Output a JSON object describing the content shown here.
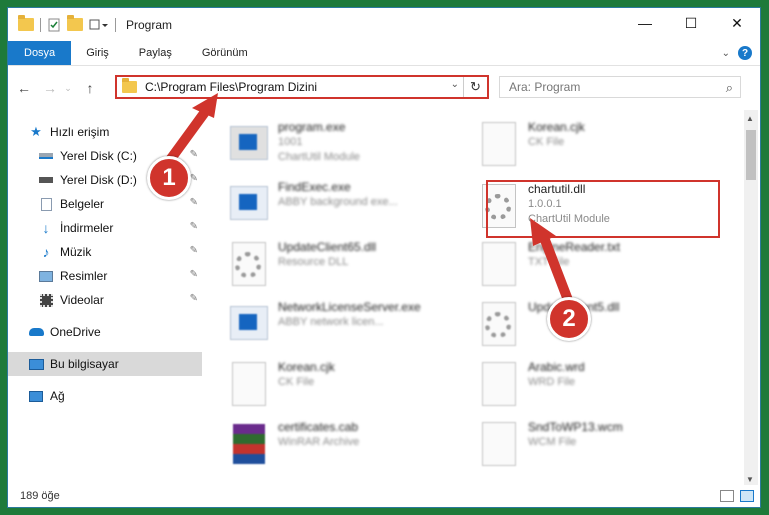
{
  "window": {
    "title": "Program",
    "controls": {
      "minimize": "—",
      "maximize": "☐",
      "close": "✕"
    }
  },
  "ribbon": {
    "tabs": [
      {
        "label": "Dosya",
        "active": true
      },
      {
        "label": "Giriş"
      },
      {
        "label": "Paylaş"
      },
      {
        "label": "Görünüm"
      }
    ],
    "help_label": "?"
  },
  "nav": {
    "address": "C:\\Program Files\\Program Dizini",
    "search_placeholder": "Ara: Program"
  },
  "sidebar": {
    "items": [
      {
        "label": "Hızlı erişim",
        "icon": "star-icon"
      },
      {
        "label": "Yerel Disk (C:)",
        "icon": "drive-icon",
        "pinned": true
      },
      {
        "label": "Yerel Disk (D:)",
        "icon": "drive-icon",
        "pinned": true
      },
      {
        "label": "Belgeler",
        "icon": "documents-icon",
        "pinned": true
      },
      {
        "label": "İndirmeler",
        "icon": "download-icon",
        "pinned": true
      },
      {
        "label": "Müzik",
        "icon": "music-icon",
        "pinned": true
      },
      {
        "label": "Resimler",
        "icon": "pictures-icon",
        "pinned": true
      },
      {
        "label": "Videolar",
        "icon": "video-icon",
        "pinned": true
      },
      {
        "label": "OneDrive",
        "icon": "cloud-icon"
      },
      {
        "label": "Bu bilgisayar",
        "icon": "computer-icon",
        "selected": true
      },
      {
        "label": "Ağ",
        "icon": "network-icon"
      }
    ]
  },
  "files": [
    {
      "name": "program.exe",
      "line1": "1001",
      "line2": "ChartUtil Module",
      "icon": "installer-icon"
    },
    {
      "name": "Korean.cjk",
      "line1": "CK File",
      "line2": "",
      "icon": "document-icon"
    },
    {
      "name": "FindExec.exe",
      "line1": "ABBY background exe...",
      "line2": "",
      "icon": "exe-icon"
    },
    {
      "name": "chartutil.dll",
      "line1": "1.0.0.1",
      "line2": "ChartUtil Module",
      "icon": "dll-gear-icon"
    },
    {
      "name": "UpdateClient65.dll",
      "line1": "Resource DLL",
      "line2": "",
      "icon": "dll-gear-icon"
    },
    {
      "name": "EngineReader.txt",
      "line1": "TXT File",
      "line2": "",
      "icon": "document-icon"
    },
    {
      "name": "NetworkLicenseServer.exe",
      "line1": "ABBY network licen...",
      "line2": "",
      "icon": "exe-icon"
    },
    {
      "name": "UpdateClient5.dll",
      "line1": "",
      "line2": "",
      "icon": "dll-gear-icon"
    },
    {
      "name": "Korean.cjk",
      "line1": "CK File",
      "line2": "",
      "icon": "document-icon"
    },
    {
      "name": "Arabic.wrd",
      "line1": "WRD File",
      "line2": "",
      "icon": "document-icon"
    },
    {
      "name": "certificates.cab",
      "line1": "WinRAR Archive",
      "line2": "",
      "icon": "archive-icon"
    },
    {
      "name": "SndToWP13.wcm",
      "line1": "WCM File",
      "line2": "",
      "icon": "document-icon"
    }
  ],
  "status": {
    "item_count": "189 öğe"
  },
  "annotations": {
    "step1": "1",
    "step2": "2"
  },
  "colors": {
    "accent": "#1979ca",
    "highlight": "#d0342c"
  }
}
